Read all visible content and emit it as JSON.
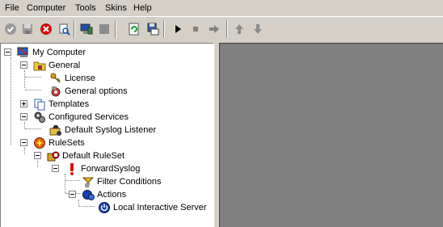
{
  "menu": {
    "file": "File",
    "computer": "Computer",
    "tools": "Tools",
    "skins": "Skins",
    "help": "Help"
  },
  "toolbar_icons": [
    "check-icon",
    "save-icon",
    "stop-red-icon",
    "search-icon",
    "computer-icon",
    "gray-block-icon",
    "refresh-icon",
    "save-config-icon",
    "play-icon",
    "stop-icon",
    "step-icon",
    "arrow-up-icon",
    "arrow-down-icon"
  ],
  "tree": {
    "my_computer": "My Computer",
    "general": "General",
    "license": "License",
    "general_options": "General options",
    "templates": "Templates",
    "configured_services": "Configured Services",
    "default_syslog_listener": "Default Syslog Listener",
    "rulesets": "RuleSets",
    "default_ruleset": "Default RuleSet",
    "forward_syslog": "ForwardSyslog",
    "filter_conditions": "Filter Conditions",
    "actions": "Actions",
    "local_interactive_server": "Local Interactive Server"
  },
  "colors": {
    "window_bg": "#d4d0c8",
    "tree_bg": "#ffffff",
    "right_panel_bg": "#808080"
  }
}
